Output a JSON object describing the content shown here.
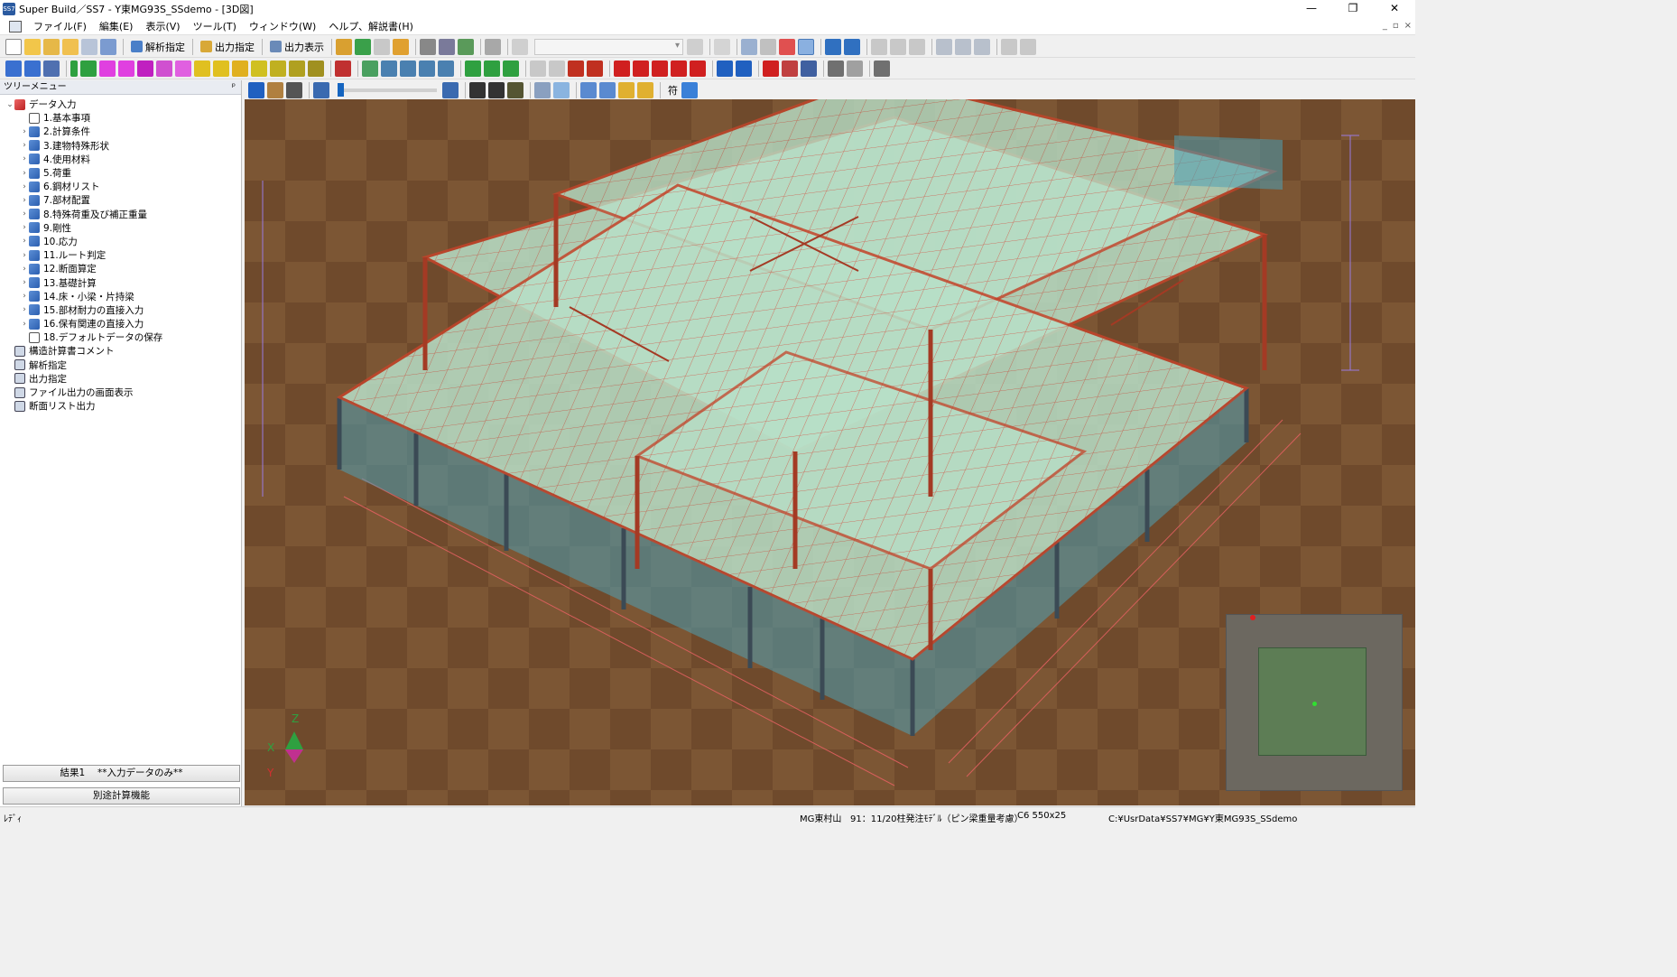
{
  "window": {
    "title": "Super Build／SS7 - Y東MG93S_SSdemo - [3D図]",
    "app_badge": "SS7",
    "controls": {
      "minimize": "—",
      "restore": "❐",
      "close": "✕"
    }
  },
  "menubar": [
    "ファイル(F)",
    "編集(E)",
    "表示(V)",
    "ツール(T)",
    "ウィンドウ(W)",
    "ヘルプ、解説書(H)"
  ],
  "toolbar1": {
    "analysis_label": "解析指定",
    "output_spec_label": "出力指定",
    "output_view_label": "出力表示"
  },
  "viewtoolbar": {
    "symbol_label": "符"
  },
  "sidebar": {
    "header": "ツリーメニュー",
    "pin": "ᵖ",
    "tree": [
      {
        "label": "データ入力",
        "level": 0,
        "expander": "⌄",
        "icon": "red"
      },
      {
        "label": "1.基本事項",
        "level": 1,
        "expander": "",
        "icon": "doc"
      },
      {
        "label": "2.計算条件",
        "level": 1,
        "expander": "›",
        "icon": "blue"
      },
      {
        "label": "3.建物特殊形状",
        "level": 1,
        "expander": "›",
        "icon": "blue"
      },
      {
        "label": "4.使用材料",
        "level": 1,
        "expander": "›",
        "icon": "blue"
      },
      {
        "label": "5.荷重",
        "level": 1,
        "expander": "›",
        "icon": "blue"
      },
      {
        "label": "6.鋼材リスト",
        "level": 1,
        "expander": "›",
        "icon": "blue"
      },
      {
        "label": "7.部材配置",
        "level": 1,
        "expander": "›",
        "icon": "blue"
      },
      {
        "label": "8.特殊荷重及び補正重量",
        "level": 1,
        "expander": "›",
        "icon": "blue"
      },
      {
        "label": "9.剛性",
        "level": 1,
        "expander": "›",
        "icon": "blue"
      },
      {
        "label": "10.応力",
        "level": 1,
        "expander": "›",
        "icon": "blue"
      },
      {
        "label": "11.ルート判定",
        "level": 1,
        "expander": "›",
        "icon": "blue"
      },
      {
        "label": "12.断面算定",
        "level": 1,
        "expander": "›",
        "icon": "blue"
      },
      {
        "label": "13.基礎計算",
        "level": 1,
        "expander": "›",
        "icon": "blue"
      },
      {
        "label": "14.床・小梁・片持梁",
        "level": 1,
        "expander": "›",
        "icon": "blue"
      },
      {
        "label": "15.部材耐力の直接入力",
        "level": 1,
        "expander": "›",
        "icon": "blue"
      },
      {
        "label": "16.保有関連の直接入力",
        "level": 1,
        "expander": "›",
        "icon": "blue"
      },
      {
        "label": "18.デフォルトデータの保存",
        "level": 1,
        "expander": "",
        "icon": "doc"
      },
      {
        "label": "構造計算書コメント",
        "level": 0,
        "expander": "",
        "icon": "list"
      },
      {
        "label": "解析指定",
        "level": 0,
        "expander": "",
        "icon": "list"
      },
      {
        "label": "出力指定",
        "level": 0,
        "expander": "",
        "icon": "list"
      },
      {
        "label": "ファイル出力の画面表示",
        "level": 0,
        "expander": "",
        "icon": "list"
      },
      {
        "label": "断面リスト出力",
        "level": 0,
        "expander": "",
        "icon": "list"
      }
    ],
    "result_button": "結果1　 **入力データのみ**",
    "separate_calc_button": "別途計算機能"
  },
  "viewport": {
    "axis_labels": {
      "z": "Z",
      "x": "X",
      "y": "Y"
    },
    "colors": {
      "floor": "#6f4a2c",
      "beam": "#c4442a",
      "slab": "#b8e0c8",
      "column": "#3b4a55",
      "glass": "#4fa0b4",
      "grid": "#e05050"
    }
  },
  "statusbar": {
    "ready": "ﾚﾃﾞｨ",
    "building": "MG東村山",
    "model": "91：11/20柱発注ﾓﾃﾞﾙ（ピン梁重量考慮）",
    "section": "C6 550x25",
    "path": "C:¥UsrData¥SS7¥MG¥Y東MG93S_SSdemo"
  }
}
